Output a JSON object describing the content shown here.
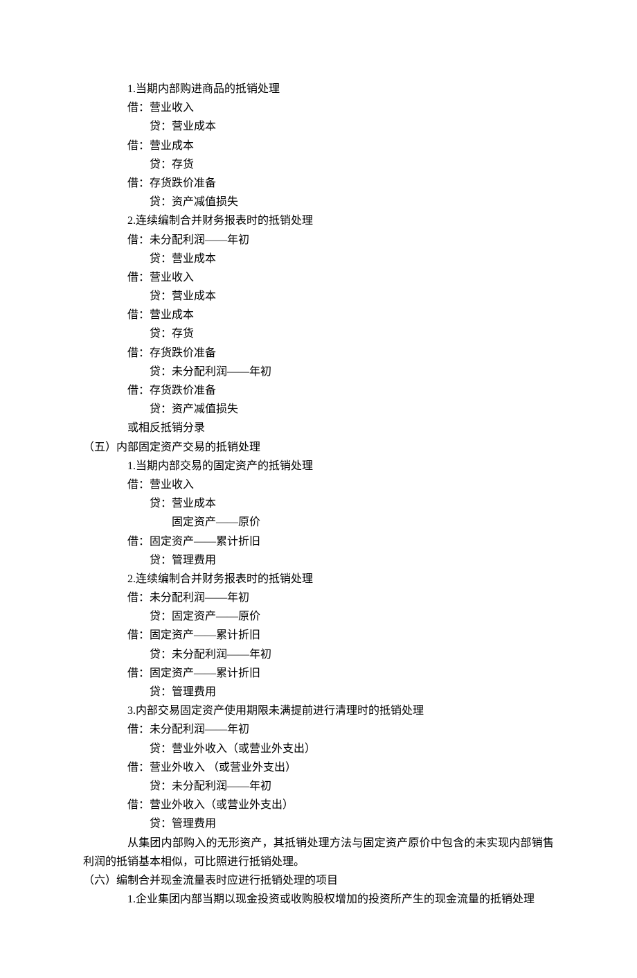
{
  "lines": [
    {
      "cls": "indent2",
      "text": "1.当期内部购进商品的抵销处理"
    },
    {
      "cls": "indent2",
      "text": "借：营业收入"
    },
    {
      "cls": "indent3",
      "text": "贷：营业成本"
    },
    {
      "cls": "indent2",
      "text": "借：营业成本"
    },
    {
      "cls": "indent3",
      "text": "贷：存货"
    },
    {
      "cls": "indent2",
      "text": "借：存货跌价准备"
    },
    {
      "cls": "indent3",
      "text": "贷：资产减值损失"
    },
    {
      "cls": "indent2",
      "text": "2.连续编制合并财务报表时的抵销处理"
    },
    {
      "cls": "indent2",
      "text": "借：未分配利润——年初"
    },
    {
      "cls": "indent3",
      "text": "贷：营业成本"
    },
    {
      "cls": "indent2",
      "text": "借：营业收入"
    },
    {
      "cls": "indent3",
      "text": "贷：营业成本"
    },
    {
      "cls": "indent2",
      "text": "借：营业成本"
    },
    {
      "cls": "indent3",
      "text": "贷：存货"
    },
    {
      "cls": "indent2",
      "text": "借：存货跌价准备"
    },
    {
      "cls": "indent3",
      "text": "贷：未分配利润——年初"
    },
    {
      "cls": "indent2",
      "text": "借：存货跌价准备"
    },
    {
      "cls": "indent3",
      "text": "贷：资产减值损失"
    },
    {
      "cls": "indent2",
      "text": "或相反抵销分录"
    },
    {
      "cls": "indent0",
      "text": "（五）内部固定资产交易的抵销处理"
    },
    {
      "cls": "indent2",
      "text": "1.当期内部交易的固定资产的抵销处理"
    },
    {
      "cls": "indent2",
      "text": "借：营业收入"
    },
    {
      "cls": "indent3",
      "text": "贷：营业成本"
    },
    {
      "cls": "indent4",
      "text": "固定资产——原价"
    },
    {
      "cls": "indent2",
      "text": "借：固定资产——累计折旧"
    },
    {
      "cls": "indent3",
      "text": "贷：管理费用"
    },
    {
      "cls": "indent2",
      "text": "2.连续编制合并财务报表时的抵销处理"
    },
    {
      "cls": "indent2",
      "text": "借：未分配利润——年初"
    },
    {
      "cls": "indent3",
      "text": "贷：固定资产——原价"
    },
    {
      "cls": "indent2",
      "text": "借：固定资产——累计折旧"
    },
    {
      "cls": "indent3",
      "text": "贷：未分配利润——年初"
    },
    {
      "cls": "indent2",
      "text": "借：固定资产——累计折旧"
    },
    {
      "cls": "indent3",
      "text": "贷：管理费用"
    },
    {
      "cls": "indent2",
      "text": "3.内部交易固定资产使用期限未满提前进行清理时的抵销处理"
    },
    {
      "cls": "indent2",
      "text": "借：未分配利润——年初"
    },
    {
      "cls": "indent3",
      "text": "贷：营业外收入（或营业外支出）"
    },
    {
      "cls": "indent2",
      "text": "借：营业外收入 （或营业外支出）"
    },
    {
      "cls": "indent3",
      "text": "贷：未分配利润——年初"
    },
    {
      "cls": "indent2",
      "text": "借：营业外收入（或营业外支出）"
    },
    {
      "cls": "indent3",
      "text": "贷：管理费用"
    }
  ],
  "paragraph": "从集团内部购入的无形资产，其抵销处理方法与固定资产原价中包含的未实现内部销售利润的抵销基本相似，可比照进行抵销处理。",
  "tail": [
    {
      "cls": "indent0",
      "text": "（六）编制合并现金流量表时应进行抵销处理的项目"
    },
    {
      "cls": "indent2",
      "text": "1.企业集团内部当期以现金投资或收购股权增加的投资所产生的现金流量的抵销处理"
    }
  ]
}
